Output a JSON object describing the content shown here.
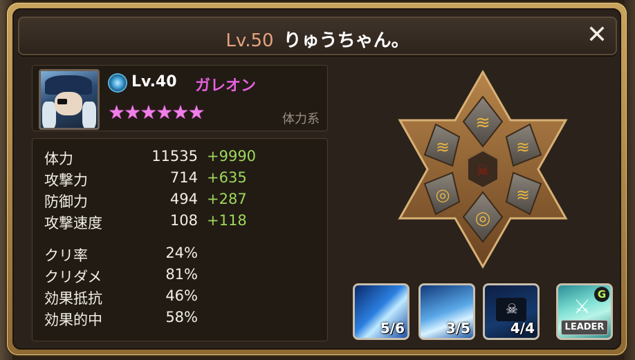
{
  "header": {
    "player_level": "Lv.50",
    "player_name": "りゅうちゃん。",
    "close_label": "✕"
  },
  "monster": {
    "element_icon": "wind-element-icon",
    "level": "Lv.40",
    "name": "ガレオン",
    "stars": "★★★★★★",
    "star_count": 6,
    "type": "体力系",
    "colors": {
      "name": "#e85fe0",
      "stars": "#f07fe9",
      "bonus": "#9ed85c"
    }
  },
  "stats": [
    {
      "label": "体力",
      "value": "11535",
      "bonus": "+9990"
    },
    {
      "label": "攻撃力",
      "value": "714",
      "bonus": "+635"
    },
    {
      "label": "防御力",
      "value": "494",
      "bonus": "+287"
    },
    {
      "label": "攻撃速度",
      "value": "108",
      "bonus": "+118"
    },
    {
      "label": "クリ率",
      "value": "24%",
      "bonus": ""
    },
    {
      "label": "クリダメ",
      "value": "81%",
      "bonus": ""
    },
    {
      "label": "効果抵抗",
      "value": "46%",
      "bonus": ""
    },
    {
      "label": "効果的中",
      "value": "58%",
      "bonus": ""
    }
  ],
  "runes": {
    "center_icon": "monster-crest-icon",
    "slots": [
      {
        "slot": 1,
        "icon": "swift-rune-icon"
      },
      {
        "slot": 2,
        "icon": "swift-rune-icon"
      },
      {
        "slot": 3,
        "icon": "swift-rune-icon"
      },
      {
        "slot": 4,
        "icon": "energy-rune-icon"
      },
      {
        "slot": 5,
        "icon": "energy-rune-icon"
      },
      {
        "slot": 6,
        "icon": "swift-rune-icon"
      }
    ]
  },
  "skills": [
    {
      "icon": "skill-1-icon",
      "level": "5/6"
    },
    {
      "icon": "skill-2-icon",
      "level": "3/5"
    },
    {
      "icon": "pirate-flag-skill-icon",
      "level": "4/4"
    },
    {
      "icon": "leader-skill-icon",
      "label": "LEADER",
      "badge": "G"
    }
  ]
}
